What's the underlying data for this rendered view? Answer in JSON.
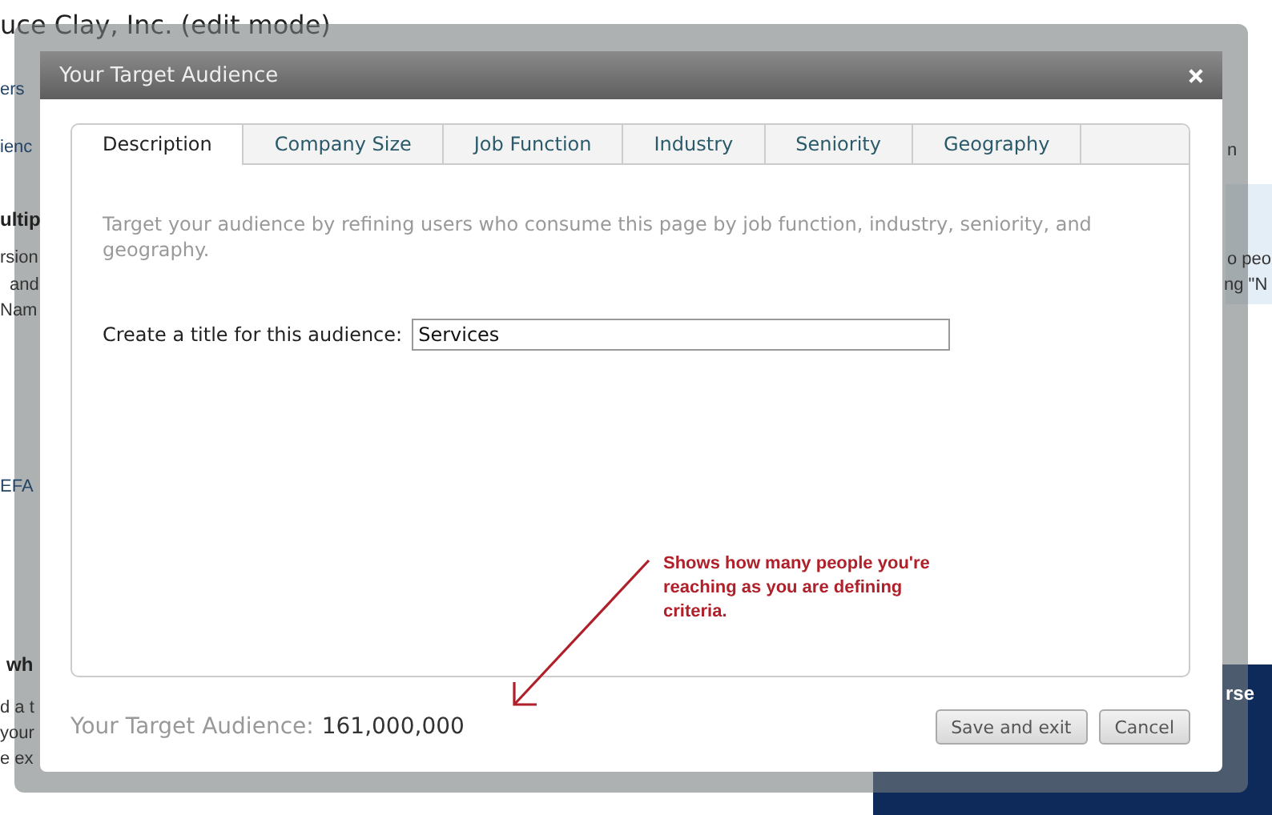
{
  "background": {
    "page_title": "uce Clay, Inc. (edit mode)",
    "fragments": [
      "ers",
      "ienc",
      "ultip",
      "rsion",
      "and",
      "Nam",
      "EFA",
      "wh",
      "d a t",
      "your",
      "e ex",
      "n",
      "o peo",
      "ng \"N",
      "rse"
    ]
  },
  "dialog": {
    "title": "Your Target Audience",
    "tabs": [
      {
        "label": "Description",
        "selected": true
      },
      {
        "label": "Company Size",
        "selected": false
      },
      {
        "label": "Job Function",
        "selected": false
      },
      {
        "label": "Industry",
        "selected": false
      },
      {
        "label": "Seniority",
        "selected": false
      },
      {
        "label": "Geography",
        "selected": false
      }
    ],
    "intro": "Target your audience by refining users who consume this page by job function, industry, seniority, and geography.",
    "title_field": {
      "label": "Create a title for this audience:",
      "value": "Services"
    },
    "annotation": "Shows how many people you're reaching as you are defining criteria.",
    "audience": {
      "label": "Your Target Audience:",
      "count": "161,000,000"
    },
    "buttons": [
      "Save and exit",
      "Cancel"
    ]
  }
}
